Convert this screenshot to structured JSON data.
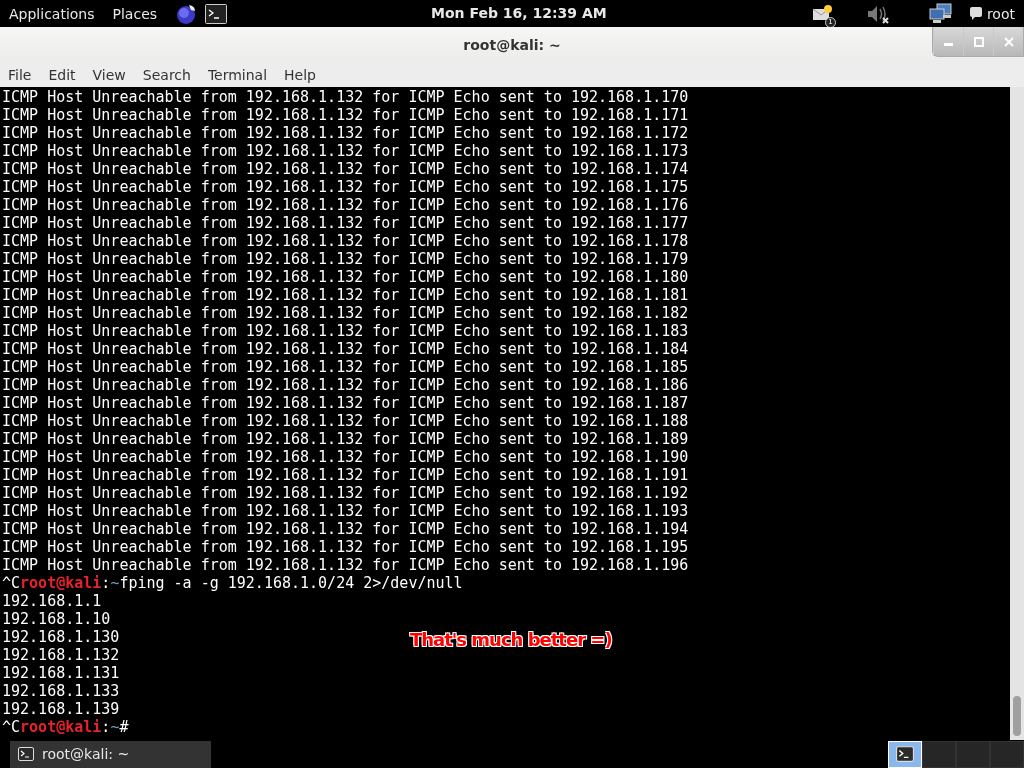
{
  "top_panel": {
    "menus": [
      "Applications",
      "Places"
    ],
    "clock": "Mon Feb 16, 12:39 AM",
    "notification_count": "1",
    "user": "root"
  },
  "window": {
    "title": "root@kali: ~",
    "menu": [
      "File",
      "Edit",
      "View",
      "Search",
      "Terminal",
      "Help"
    ]
  },
  "terminal": {
    "lines": [
      {
        "kind": "output",
        "text": "ICMP Host Unreachable from 192.168.1.132 for ICMP Echo sent to 192.168.1.170"
      },
      {
        "kind": "output",
        "text": "ICMP Host Unreachable from 192.168.1.132 for ICMP Echo sent to 192.168.1.171"
      },
      {
        "kind": "output",
        "text": "ICMP Host Unreachable from 192.168.1.132 for ICMP Echo sent to 192.168.1.172"
      },
      {
        "kind": "output",
        "text": "ICMP Host Unreachable from 192.168.1.132 for ICMP Echo sent to 192.168.1.173"
      },
      {
        "kind": "output",
        "text": "ICMP Host Unreachable from 192.168.1.132 for ICMP Echo sent to 192.168.1.174"
      },
      {
        "kind": "output",
        "text": "ICMP Host Unreachable from 192.168.1.132 for ICMP Echo sent to 192.168.1.175"
      },
      {
        "kind": "output",
        "text": "ICMP Host Unreachable from 192.168.1.132 for ICMP Echo sent to 192.168.1.176"
      },
      {
        "kind": "output",
        "text": "ICMP Host Unreachable from 192.168.1.132 for ICMP Echo sent to 192.168.1.177"
      },
      {
        "kind": "output",
        "text": "ICMP Host Unreachable from 192.168.1.132 for ICMP Echo sent to 192.168.1.178"
      },
      {
        "kind": "output",
        "text": "ICMP Host Unreachable from 192.168.1.132 for ICMP Echo sent to 192.168.1.179"
      },
      {
        "kind": "output",
        "text": "ICMP Host Unreachable from 192.168.1.132 for ICMP Echo sent to 192.168.1.180"
      },
      {
        "kind": "output",
        "text": "ICMP Host Unreachable from 192.168.1.132 for ICMP Echo sent to 192.168.1.181"
      },
      {
        "kind": "output",
        "text": "ICMP Host Unreachable from 192.168.1.132 for ICMP Echo sent to 192.168.1.182"
      },
      {
        "kind": "output",
        "text": "ICMP Host Unreachable from 192.168.1.132 for ICMP Echo sent to 192.168.1.183"
      },
      {
        "kind": "output",
        "text": "ICMP Host Unreachable from 192.168.1.132 for ICMP Echo sent to 192.168.1.184"
      },
      {
        "kind": "output",
        "text": "ICMP Host Unreachable from 192.168.1.132 for ICMP Echo sent to 192.168.1.185"
      },
      {
        "kind": "output",
        "text": "ICMP Host Unreachable from 192.168.1.132 for ICMP Echo sent to 192.168.1.186"
      },
      {
        "kind": "output",
        "text": "ICMP Host Unreachable from 192.168.1.132 for ICMP Echo sent to 192.168.1.187"
      },
      {
        "kind": "output",
        "text": "ICMP Host Unreachable from 192.168.1.132 for ICMP Echo sent to 192.168.1.188"
      },
      {
        "kind": "output",
        "text": "ICMP Host Unreachable from 192.168.1.132 for ICMP Echo sent to 192.168.1.189"
      },
      {
        "kind": "output",
        "text": "ICMP Host Unreachable from 192.168.1.132 for ICMP Echo sent to 192.168.1.190"
      },
      {
        "kind": "output",
        "text": "ICMP Host Unreachable from 192.168.1.132 for ICMP Echo sent to 192.168.1.191"
      },
      {
        "kind": "output",
        "text": "ICMP Host Unreachable from 192.168.1.132 for ICMP Echo sent to 192.168.1.192"
      },
      {
        "kind": "output",
        "text": "ICMP Host Unreachable from 192.168.1.132 for ICMP Echo sent to 192.168.1.193"
      },
      {
        "kind": "output",
        "text": "ICMP Host Unreachable from 192.168.1.132 for ICMP Echo sent to 192.168.1.194"
      },
      {
        "kind": "output",
        "text": "ICMP Host Unreachable from 192.168.1.132 for ICMP Echo sent to 192.168.1.195"
      },
      {
        "kind": "output",
        "text": "ICMP Host Unreachable from 192.168.1.132 for ICMP Echo sent to 192.168.1.196"
      },
      {
        "kind": "prompt",
        "prefix": "^C",
        "user": "root@kali",
        "sep": ":",
        "path": "~",
        "text": "fping -a -g 192.168.1.0/24 2>/dev/null"
      },
      {
        "kind": "output",
        "text": "192.168.1.1"
      },
      {
        "kind": "output",
        "text": "192.168.1.10"
      },
      {
        "kind": "output",
        "text": "192.168.1.130"
      },
      {
        "kind": "output",
        "text": "192.168.1.132"
      },
      {
        "kind": "output",
        "text": "192.168.1.131"
      },
      {
        "kind": "output",
        "text": "192.168.1.133"
      },
      {
        "kind": "output",
        "text": "192.168.1.139"
      },
      {
        "kind": "prompt",
        "prefix": "^C",
        "user": "root@kali",
        "sep": ":",
        "path": "~",
        "text": "#"
      }
    ],
    "annotation": "That's much better =)"
  },
  "taskbar": {
    "window_button": "root@kali: ~",
    "workspaces": [
      {
        "selected": true
      },
      {
        "selected": false
      },
      {
        "selected": false
      },
      {
        "selected": false
      }
    ]
  }
}
